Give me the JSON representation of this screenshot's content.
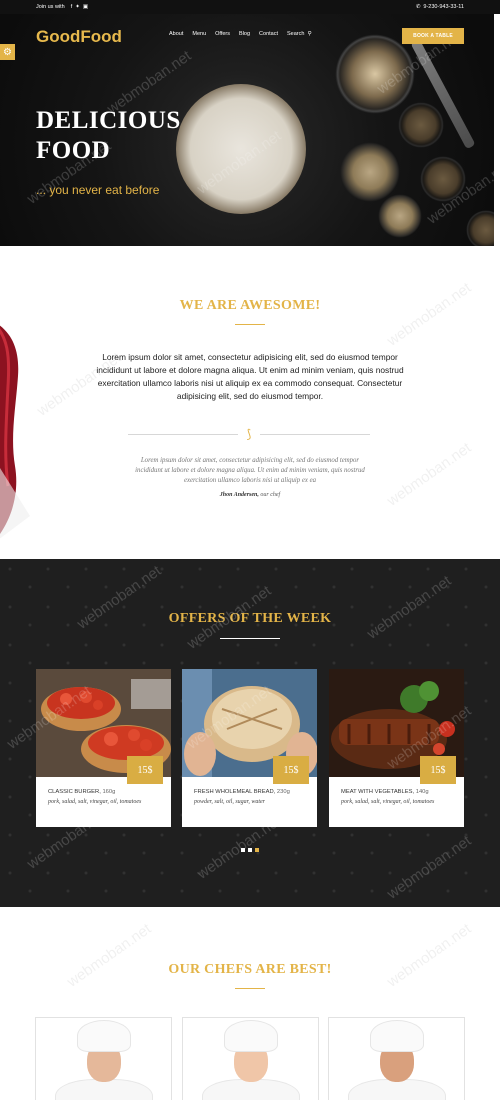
{
  "topbar": {
    "join_label": "Join us with",
    "social_icons": [
      "facebook-icon",
      "twitter-icon",
      "instagram-icon"
    ],
    "phone": "9-230-943-33-11"
  },
  "header": {
    "logo": "GoodFood",
    "nav": [
      "About",
      "Menu",
      "Offers",
      "Blog",
      "Contact",
      "Search"
    ],
    "book_button": "BOOK A TABLE"
  },
  "hero": {
    "title_line1": "DELICIOUS",
    "title_line2": "FOOD",
    "subtitle": "... you never eat before"
  },
  "watermark": "webmoban.net",
  "about": {
    "title": "WE ARE AWESOME!",
    "lead": "Lorem ipsum dolor sit amet, consectetur adipisicing elit, sed do eiusmod tempor incididunt ut labore et dolore magna aliqua. Ut enim ad minim veniam, quis nostrud exercitation ullamco laboris nisi ut aliquip ex ea commodo consequat. Consectetur adipisicing elit, sed do eiusmod tempor.",
    "quote": "Lorem ipsum dolor sit amet, consectetur adipisicing elit, sed do eiusmod tempor incididunt ut labore et dolore magna aliqua. Ut enim ad minim veniam, quis nostrud exercitation ullamco laboris nisi ut aliquip ex ea",
    "author_name": "Jhon Andersen,",
    "author_role": " our chef"
  },
  "offers": {
    "title": "OFFERS OF THE WEEK",
    "items": [
      {
        "name": "CLASSIC BURGER,",
        "weight": " 160g",
        "desc": "pork, salad, salt, vinegar, oil, tomatoes",
        "price": "15$"
      },
      {
        "name": "FRESH WHOLEMEAL BREAD,",
        "weight": " 230g",
        "desc": "powder, salt, oil, sugar, water",
        "price": "15$"
      },
      {
        "name": "MEAT WITH VEGETABLES,",
        "weight": " 140g",
        "desc": "pork, salad, salt, vinegar, oil, tomatoes",
        "price": "15$"
      }
    ]
  },
  "chefs": {
    "title": "OUR CHEFS ARE BEST!"
  },
  "colors": {
    "accent": "#e3b448",
    "dark_bg": "#1f1f1f",
    "topbar_bg": "#111111"
  }
}
